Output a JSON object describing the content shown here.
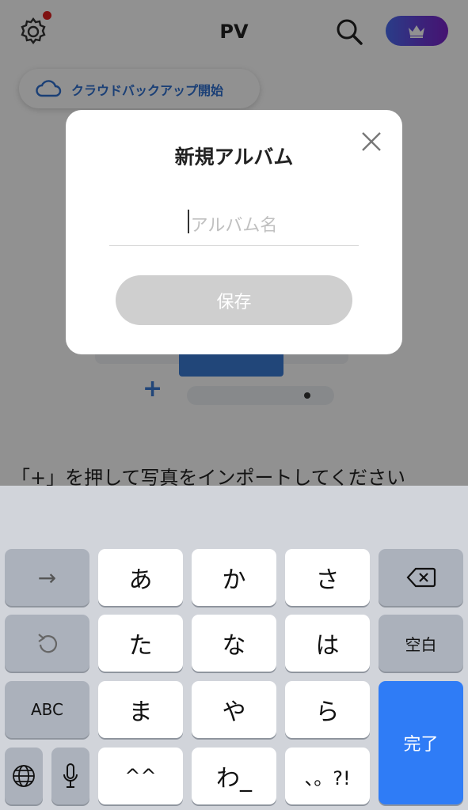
{
  "app": {
    "title": "PV",
    "backup_label": "クラウドバックアップ開始",
    "empty_hint": "「+」を押して写真をインポートしてください",
    "plus_symbol": "+",
    "notification_color": "#e02020",
    "accent_color": "#2f6fd0"
  },
  "modal": {
    "title": "新規アルバム",
    "input_placeholder": "アルバム名",
    "input_value": "",
    "save_label": "保存",
    "close_icon": "close-icon"
  },
  "keyboard": {
    "row1": [
      "あ",
      "か",
      "さ"
    ],
    "row2": [
      "た",
      "な",
      "は"
    ],
    "row3": [
      "ま",
      "や",
      "ら"
    ],
    "row4": [
      "^^",
      "わ_",
      "、。?!"
    ],
    "next_key": "→",
    "space_label": "空白",
    "abc_label": "ABC",
    "done_label": "完了",
    "done_color": "#2f7cf6",
    "icons": [
      "undo-icon",
      "globe-icon",
      "microphone-icon",
      "backspace-icon"
    ]
  }
}
